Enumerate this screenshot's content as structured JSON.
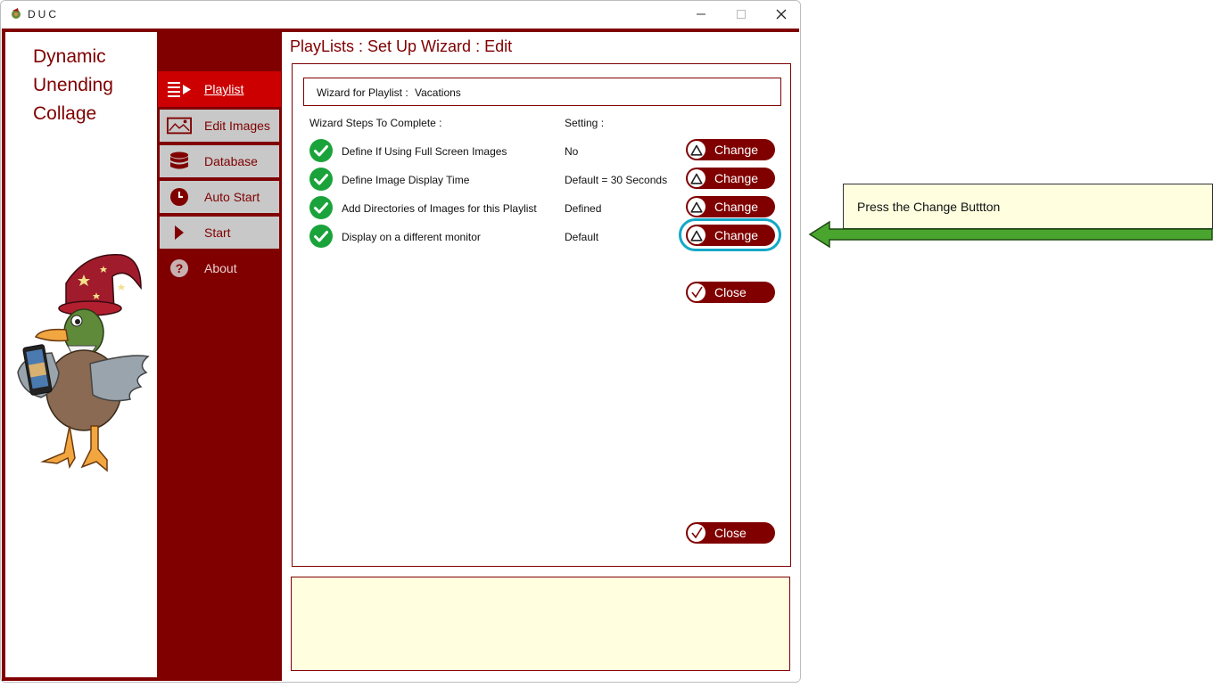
{
  "window": {
    "title": "DUC",
    "controls": [
      "minimize-icon",
      "maximize-icon",
      "close-icon"
    ]
  },
  "brand": {
    "line1": "Dynamic",
    "line2": "Unending",
    "line3": "Collage"
  },
  "nav": {
    "items": [
      {
        "label": "Playlist",
        "icon": "playlist-icon",
        "state": "active"
      },
      {
        "label": "Edit Images",
        "icon": "image-icon",
        "state": "normal"
      },
      {
        "label": "Database",
        "icon": "database-icon",
        "state": "normal"
      },
      {
        "label": "Auto Start",
        "icon": "clock-icon",
        "state": "normal"
      },
      {
        "label": "Start",
        "icon": "play-icon",
        "state": "normal"
      },
      {
        "label": "About",
        "icon": "help-icon",
        "state": "plain"
      }
    ]
  },
  "page": {
    "title": "PlayLists : Set Up Wizard : Edit"
  },
  "wizard": {
    "playlist_label": "Wizard for Playlist :",
    "playlist_name": "Vacations",
    "steps_header": "Wizard Steps To Complete :",
    "setting_header": "Setting :",
    "steps": [
      {
        "label": "Define If Using Full Screen Images",
        "setting": "No",
        "button": "Change",
        "done": true
      },
      {
        "label": "Define Image Display Time",
        "setting": "Default = 30 Seconds",
        "button": "Change",
        "done": true
      },
      {
        "label": "Add Directories of Images for this Playlist",
        "setting": "Defined",
        "button": "Change",
        "done": true
      },
      {
        "label": "Display on a different monitor",
        "setting": "Default",
        "button": "Change",
        "done": true
      }
    ],
    "close_label_top": "Close",
    "close_label_bottom": "Close"
  },
  "info_box": {
    "text": ""
  },
  "callout": {
    "text": "Press the Change Buttton"
  },
  "colors": {
    "brand": "#800000",
    "active_nav": "#cc0000",
    "check": "#1aa33a",
    "highlight": "#13a8c8",
    "note_bg": "#ffffe0",
    "arrow": "#4aa52e"
  }
}
